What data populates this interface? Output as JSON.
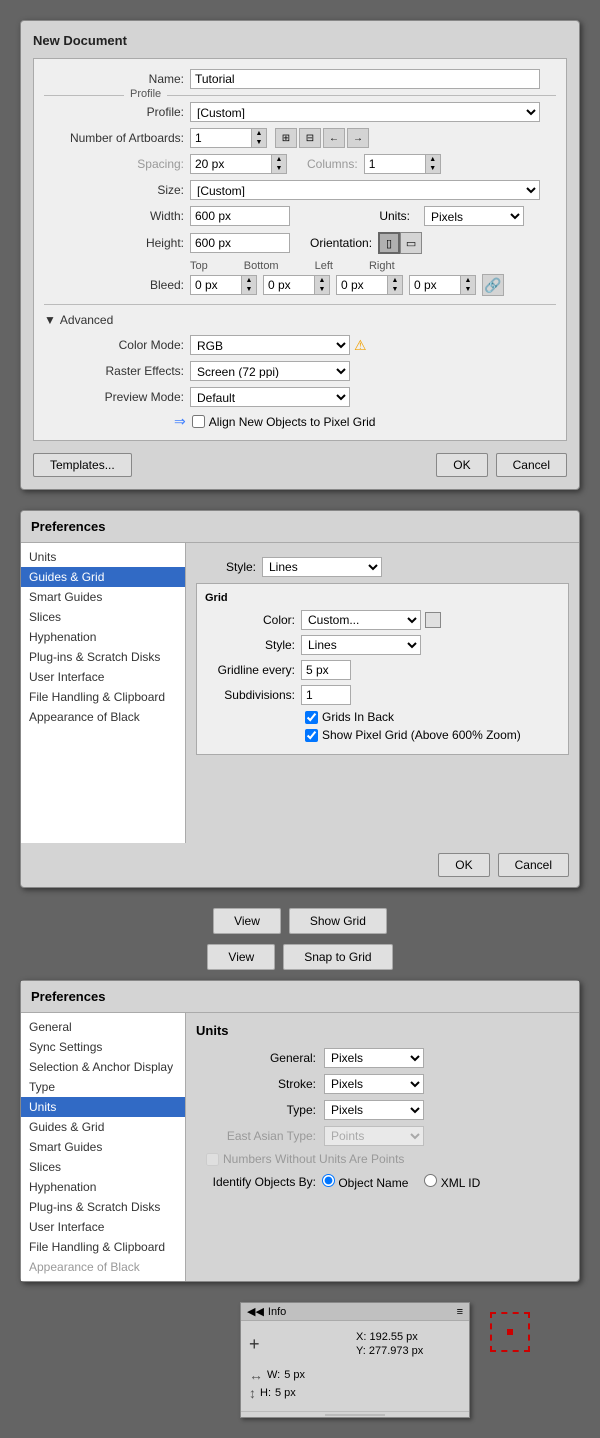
{
  "new_document": {
    "title": "New Document",
    "name_label": "Name:",
    "name_value": "Tutorial",
    "profile_label": "Profile:",
    "profile_value": "[Custom]",
    "artboards_label": "Number of Artboards:",
    "artboards_value": "1",
    "spacing_label": "Spacing:",
    "spacing_value": "20 px",
    "columns_label": "Columns:",
    "columns_value": "1",
    "size_label": "Size:",
    "size_value": "[Custom]",
    "width_label": "Width:",
    "width_value": "600 px",
    "units_label": "Units:",
    "units_value": "Pixels",
    "height_label": "Height:",
    "height_value": "600 px",
    "orientation_label": "Orientation:",
    "bleed_label": "Bleed:",
    "bleed_top_header": "Top",
    "bleed_bottom_header": "Bottom",
    "bleed_left_header": "Left",
    "bleed_right_header": "Right",
    "bleed_top": "0 px",
    "bleed_bottom": "0 px",
    "bleed_left": "0 px",
    "bleed_right": "0 px",
    "advanced_label": "Advanced",
    "color_mode_label": "Color Mode:",
    "color_mode_value": "RGB",
    "raster_label": "Raster Effects:",
    "raster_value": "Screen (72 ppi)",
    "preview_label": "Preview Mode:",
    "preview_value": "Default",
    "pixel_grid_label": "Align New Objects to Pixel Grid",
    "templates_btn": "Templates...",
    "ok_btn": "OK",
    "cancel_btn": "Cancel"
  },
  "preferences_grid": {
    "title": "Preferences",
    "sidebar_items": [
      "Units",
      "Guides & Grid",
      "Smart Guides",
      "Slices",
      "Hyphenation",
      "Plug-ins & Scratch Disks",
      "User Interface",
      "File Handling & Clipboard",
      "Appearance of Black"
    ],
    "active_item": "Guides & Grid",
    "guides_section": {
      "style_label": "Style:",
      "style_value": "Lines"
    },
    "grid_section": {
      "title": "Grid",
      "color_label": "Color:",
      "color_value": "Custom...",
      "style_label": "Style:",
      "style_value": "Lines",
      "gridline_label": "Gridline every:",
      "gridline_value": "5 px",
      "subdivisions_label": "Subdivisions:",
      "subdivisions_value": "1",
      "grids_in_back_label": "Grids In Back",
      "grids_in_back_checked": true,
      "show_pixel_label": "Show Pixel Grid (Above 600% Zoom)",
      "show_pixel_checked": true
    },
    "ok_btn": "OK",
    "cancel_btn": "Cancel"
  },
  "view_buttons": [
    {
      "view": "View",
      "action": "Show Grid"
    },
    {
      "view": "View",
      "action": "Snap to Grid"
    }
  ],
  "preferences_units": {
    "title": "Preferences",
    "sidebar_items": [
      "General",
      "Sync Settings",
      "Selection & Anchor Display",
      "Type",
      "Units",
      "Guides & Grid",
      "Smart Guides",
      "Slices",
      "Hyphenation",
      "Plug-ins & Scratch Disks",
      "User Interface",
      "File Handling & Clipboard",
      "Appearance of Black"
    ],
    "active_item": "Units",
    "units_section": {
      "title": "Units",
      "general_label": "General:",
      "general_value": "Pixels",
      "stroke_label": "Stroke:",
      "stroke_value": "Pixels",
      "type_label": "Type:",
      "type_value": "Pixels",
      "east_asian_label": "East Asian Type:",
      "east_asian_value": "Points",
      "east_asian_disabled": true,
      "numbers_label": "Numbers Without Units Are Points",
      "numbers_disabled": true,
      "identify_label": "Identify Objects By:",
      "identify_object_name": "Object Name",
      "identify_xml_id": "XML ID"
    }
  },
  "info_panel": {
    "title": "Info",
    "x_label": "X:",
    "x_value": "192.55 px",
    "y_label": "Y:",
    "y_value": "277.973 px",
    "w_label": "W:",
    "w_value": "5 px",
    "h_label": "H:",
    "h_value": "5 px",
    "arrows_icon": "◀◀",
    "menu_icon": "≡"
  }
}
